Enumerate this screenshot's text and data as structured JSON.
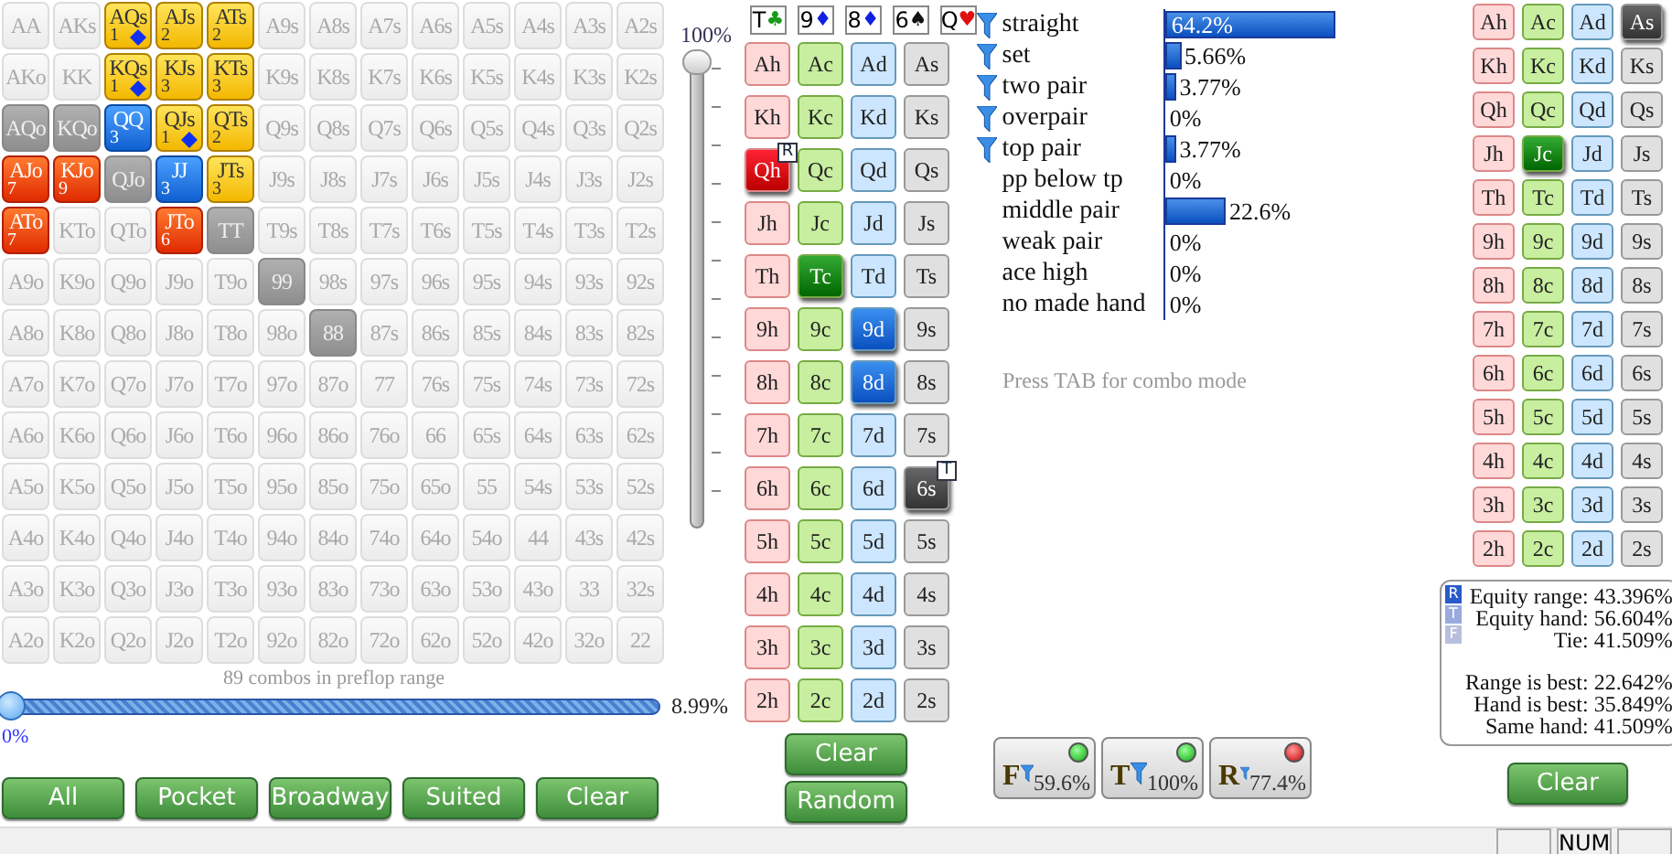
{
  "range_grid": [
    [
      {
        "label": "AA",
        "kind": "none"
      },
      {
        "label": "AKs",
        "kind": "none"
      },
      {
        "label": "AQs",
        "kind": "gold",
        "count": "1",
        "diamond": true
      },
      {
        "label": "AJs",
        "kind": "gold",
        "count": "2",
        "diamond": false
      },
      {
        "label": "ATs",
        "kind": "gold",
        "count": "2",
        "diamond": false
      },
      {
        "label": "A9s",
        "kind": "none"
      },
      {
        "label": "A8s",
        "kind": "none"
      },
      {
        "label": "A7s",
        "kind": "none"
      },
      {
        "label": "A6s",
        "kind": "none"
      },
      {
        "label": "A5s",
        "kind": "none"
      },
      {
        "label": "A4s",
        "kind": "none"
      },
      {
        "label": "A3s",
        "kind": "none"
      },
      {
        "label": "A2s",
        "kind": "none"
      }
    ],
    [
      {
        "label": "AKo",
        "kind": "none"
      },
      {
        "label": "KK",
        "kind": "none"
      },
      {
        "label": "KQs",
        "kind": "gold",
        "count": "1",
        "diamond": true
      },
      {
        "label": "KJs",
        "kind": "gold",
        "count": "3",
        "diamond": false
      },
      {
        "label": "KTs",
        "kind": "gold",
        "count": "3",
        "diamond": false
      },
      {
        "label": "K9s",
        "kind": "none"
      },
      {
        "label": "K8s",
        "kind": "none"
      },
      {
        "label": "K7s",
        "kind": "none"
      },
      {
        "label": "K6s",
        "kind": "none"
      },
      {
        "label": "K5s",
        "kind": "none"
      },
      {
        "label": "K4s",
        "kind": "none"
      },
      {
        "label": "K3s",
        "kind": "none"
      },
      {
        "label": "K2s",
        "kind": "none"
      }
    ],
    [
      {
        "label": "AQo",
        "kind": "gray"
      },
      {
        "label": "KQo",
        "kind": "gray"
      },
      {
        "label": "QQ",
        "kind": "blue",
        "count": "3",
        "diamond": false
      },
      {
        "label": "QJs",
        "kind": "gold",
        "count": "1",
        "diamond": true
      },
      {
        "label": "QTs",
        "kind": "gold",
        "count": "2",
        "diamond": false
      },
      {
        "label": "Q9s",
        "kind": "none"
      },
      {
        "label": "Q8s",
        "kind": "none"
      },
      {
        "label": "Q7s",
        "kind": "none"
      },
      {
        "label": "Q6s",
        "kind": "none"
      },
      {
        "label": "Q5s",
        "kind": "none"
      },
      {
        "label": "Q4s",
        "kind": "none"
      },
      {
        "label": "Q3s",
        "kind": "none"
      },
      {
        "label": "Q2s",
        "kind": "none"
      }
    ],
    [
      {
        "label": "AJo",
        "kind": "red",
        "count": "7",
        "diamond": false
      },
      {
        "label": "KJo",
        "kind": "red",
        "count": "9",
        "diamond": false
      },
      {
        "label": "QJo",
        "kind": "gray"
      },
      {
        "label": "JJ",
        "kind": "blue",
        "count": "3",
        "diamond": false
      },
      {
        "label": "JTs",
        "kind": "gold",
        "count": "3",
        "diamond": false
      },
      {
        "label": "J9s",
        "kind": "none"
      },
      {
        "label": "J8s",
        "kind": "none"
      },
      {
        "label": "J7s",
        "kind": "none"
      },
      {
        "label": "J6s",
        "kind": "none"
      },
      {
        "label": "J5s",
        "kind": "none"
      },
      {
        "label": "J4s",
        "kind": "none"
      },
      {
        "label": "J3s",
        "kind": "none"
      },
      {
        "label": "J2s",
        "kind": "none"
      }
    ],
    [
      {
        "label": "ATo",
        "kind": "red",
        "count": "7",
        "diamond": false
      },
      {
        "label": "KTo",
        "kind": "none"
      },
      {
        "label": "QTo",
        "kind": "none"
      },
      {
        "label": "JTo",
        "kind": "red",
        "count": "6",
        "diamond": false
      },
      {
        "label": "TT",
        "kind": "gray"
      },
      {
        "label": "T9s",
        "kind": "none"
      },
      {
        "label": "T8s",
        "kind": "none"
      },
      {
        "label": "T7s",
        "kind": "none"
      },
      {
        "label": "T6s",
        "kind": "none"
      },
      {
        "label": "T5s",
        "kind": "none"
      },
      {
        "label": "T4s",
        "kind": "none"
      },
      {
        "label": "T3s",
        "kind": "none"
      },
      {
        "label": "T2s",
        "kind": "none"
      }
    ],
    [
      {
        "label": "A9o",
        "kind": "none"
      },
      {
        "label": "K9o",
        "kind": "none"
      },
      {
        "label": "Q9o",
        "kind": "none"
      },
      {
        "label": "J9o",
        "kind": "none"
      },
      {
        "label": "T9o",
        "kind": "none"
      },
      {
        "label": "99",
        "kind": "gray"
      },
      {
        "label": "98s",
        "kind": "none"
      },
      {
        "label": "97s",
        "kind": "none"
      },
      {
        "label": "96s",
        "kind": "none"
      },
      {
        "label": "95s",
        "kind": "none"
      },
      {
        "label": "94s",
        "kind": "none"
      },
      {
        "label": "93s",
        "kind": "none"
      },
      {
        "label": "92s",
        "kind": "none"
      }
    ],
    [
      {
        "label": "A8o",
        "kind": "none"
      },
      {
        "label": "K8o",
        "kind": "none"
      },
      {
        "label": "Q8o",
        "kind": "none"
      },
      {
        "label": "J8o",
        "kind": "none"
      },
      {
        "label": "T8o",
        "kind": "none"
      },
      {
        "label": "98o",
        "kind": "none"
      },
      {
        "label": "88",
        "kind": "gray"
      },
      {
        "label": "87s",
        "kind": "none"
      },
      {
        "label": "86s",
        "kind": "none"
      },
      {
        "label": "85s",
        "kind": "none"
      },
      {
        "label": "84s",
        "kind": "none"
      },
      {
        "label": "83s",
        "kind": "none"
      },
      {
        "label": "82s",
        "kind": "none"
      }
    ],
    [
      {
        "label": "A7o",
        "kind": "none"
      },
      {
        "label": "K7o",
        "kind": "none"
      },
      {
        "label": "Q7o",
        "kind": "none"
      },
      {
        "label": "J7o",
        "kind": "none"
      },
      {
        "label": "T7o",
        "kind": "none"
      },
      {
        "label": "97o",
        "kind": "none"
      },
      {
        "label": "87o",
        "kind": "none"
      },
      {
        "label": "77",
        "kind": "none"
      },
      {
        "label": "76s",
        "kind": "none"
      },
      {
        "label": "75s",
        "kind": "none"
      },
      {
        "label": "74s",
        "kind": "none"
      },
      {
        "label": "73s",
        "kind": "none"
      },
      {
        "label": "72s",
        "kind": "none"
      }
    ],
    [
      {
        "label": "A6o",
        "kind": "none"
      },
      {
        "label": "K6o",
        "kind": "none"
      },
      {
        "label": "Q6o",
        "kind": "none"
      },
      {
        "label": "J6o",
        "kind": "none"
      },
      {
        "label": "T6o",
        "kind": "none"
      },
      {
        "label": "96o",
        "kind": "none"
      },
      {
        "label": "86o",
        "kind": "none"
      },
      {
        "label": "76o",
        "kind": "none"
      },
      {
        "label": "66",
        "kind": "none"
      },
      {
        "label": "65s",
        "kind": "none"
      },
      {
        "label": "64s",
        "kind": "none"
      },
      {
        "label": "63s",
        "kind": "none"
      },
      {
        "label": "62s",
        "kind": "none"
      }
    ],
    [
      {
        "label": "A5o",
        "kind": "none"
      },
      {
        "label": "K5o",
        "kind": "none"
      },
      {
        "label": "Q5o",
        "kind": "none"
      },
      {
        "label": "J5o",
        "kind": "none"
      },
      {
        "label": "T5o",
        "kind": "none"
      },
      {
        "label": "95o",
        "kind": "none"
      },
      {
        "label": "85o",
        "kind": "none"
      },
      {
        "label": "75o",
        "kind": "none"
      },
      {
        "label": "65o",
        "kind": "none"
      },
      {
        "label": "55",
        "kind": "none"
      },
      {
        "label": "54s",
        "kind": "none"
      },
      {
        "label": "53s",
        "kind": "none"
      },
      {
        "label": "52s",
        "kind": "none"
      }
    ],
    [
      {
        "label": "A4o",
        "kind": "none"
      },
      {
        "label": "K4o",
        "kind": "none"
      },
      {
        "label": "Q4o",
        "kind": "none"
      },
      {
        "label": "J4o",
        "kind": "none"
      },
      {
        "label": "T4o",
        "kind": "none"
      },
      {
        "label": "94o",
        "kind": "none"
      },
      {
        "label": "84o",
        "kind": "none"
      },
      {
        "label": "74o",
        "kind": "none"
      },
      {
        "label": "64o",
        "kind": "none"
      },
      {
        "label": "54o",
        "kind": "none"
      },
      {
        "label": "44",
        "kind": "none"
      },
      {
        "label": "43s",
        "kind": "none"
      },
      {
        "label": "42s",
        "kind": "none"
      }
    ],
    [
      {
        "label": "A3o",
        "kind": "none"
      },
      {
        "label": "K3o",
        "kind": "none"
      },
      {
        "label": "Q3o",
        "kind": "none"
      },
      {
        "label": "J3o",
        "kind": "none"
      },
      {
        "label": "T3o",
        "kind": "none"
      },
      {
        "label": "93o",
        "kind": "none"
      },
      {
        "label": "83o",
        "kind": "none"
      },
      {
        "label": "73o",
        "kind": "none"
      },
      {
        "label": "63o",
        "kind": "none"
      },
      {
        "label": "53o",
        "kind": "none"
      },
      {
        "label": "43o",
        "kind": "none"
      },
      {
        "label": "33",
        "kind": "none"
      },
      {
        "label": "32s",
        "kind": "none"
      }
    ],
    [
      {
        "label": "A2o",
        "kind": "none"
      },
      {
        "label": "K2o",
        "kind": "none"
      },
      {
        "label": "Q2o",
        "kind": "none"
      },
      {
        "label": "J2o",
        "kind": "none"
      },
      {
        "label": "T2o",
        "kind": "none"
      },
      {
        "label": "92o",
        "kind": "none"
      },
      {
        "label": "82o",
        "kind": "none"
      },
      {
        "label": "72o",
        "kind": "none"
      },
      {
        "label": "62o",
        "kind": "none"
      },
      {
        "label": "52o",
        "kind": "none"
      },
      {
        "label": "42o",
        "kind": "none"
      },
      {
        "label": "32o",
        "kind": "none"
      },
      {
        "label": "22",
        "kind": "none"
      }
    ]
  ],
  "vertical_slider": {
    "label": "100%",
    "level": 1
  },
  "range_slider": {
    "caption": "89 combos in preflop range",
    "level": 0,
    "min_label": "0%",
    "reading": "8.99%"
  },
  "range_buttons": [
    "All",
    "Pocket",
    "Broadway",
    "Suited",
    "Clear"
  ],
  "board": [
    {
      "rank": "T",
      "symbol": "♣",
      "kind": "clubs"
    },
    {
      "rank": "9",
      "symbol": "♦",
      "kind": "diamonds"
    },
    {
      "rank": "8",
      "symbol": "♦",
      "kind": "diamonds"
    },
    {
      "rank": "6",
      "symbol": "♠",
      "kind": "spades"
    },
    {
      "rank": "Q",
      "symbol": "♥",
      "kind": "hearts"
    }
  ],
  "deck": [
    {
      "kind": "hearts",
      "cards": [
        {
          "label": "Ah",
          "selected": false
        },
        {
          "label": "Kh",
          "selected": false
        },
        {
          "label": "Qh",
          "selected": true,
          "tag": "R"
        },
        {
          "label": "Jh",
          "selected": false
        },
        {
          "label": "Th",
          "selected": false
        },
        {
          "label": "9h",
          "selected": false
        },
        {
          "label": "8h",
          "selected": false
        },
        {
          "label": "7h",
          "selected": false
        },
        {
          "label": "6h",
          "selected": false
        },
        {
          "label": "5h",
          "selected": false
        },
        {
          "label": "4h",
          "selected": false
        },
        {
          "label": "3h",
          "selected": false
        },
        {
          "label": "2h",
          "selected": false
        }
      ]
    },
    {
      "kind": "clubs",
      "cards": [
        {
          "label": "Ac",
          "selected": false
        },
        {
          "label": "Kc",
          "selected": false
        },
        {
          "label": "Qc",
          "selected": false
        },
        {
          "label": "Jc",
          "selected": false
        },
        {
          "label": "Tc",
          "selected": true
        },
        {
          "label": "9c",
          "selected": false
        },
        {
          "label": "8c",
          "selected": false
        },
        {
          "label": "7c",
          "selected": false
        },
        {
          "label": "6c",
          "selected": false
        },
        {
          "label": "5c",
          "selected": false
        },
        {
          "label": "4c",
          "selected": false
        },
        {
          "label": "3c",
          "selected": false
        },
        {
          "label": "2c",
          "selected": false
        }
      ]
    },
    {
      "kind": "diamonds",
      "cards": [
        {
          "label": "Ad",
          "selected": false
        },
        {
          "label": "Kd",
          "selected": false
        },
        {
          "label": "Qd",
          "selected": false
        },
        {
          "label": "Jd",
          "selected": false
        },
        {
          "label": "Td",
          "selected": false
        },
        {
          "label": "9d",
          "selected": true
        },
        {
          "label": "8d",
          "selected": true
        },
        {
          "label": "7d",
          "selected": false
        },
        {
          "label": "6d",
          "selected": false
        },
        {
          "label": "5d",
          "selected": false
        },
        {
          "label": "4d",
          "selected": false
        },
        {
          "label": "3d",
          "selected": false
        },
        {
          "label": "2d",
          "selected": false
        }
      ]
    },
    {
      "kind": "spades",
      "cards": [
        {
          "label": "As",
          "selected": false
        },
        {
          "label": "Ks",
          "selected": false
        },
        {
          "label": "Qs",
          "selected": false
        },
        {
          "label": "Js",
          "selected": false
        },
        {
          "label": "Ts",
          "selected": false
        },
        {
          "label": "9s",
          "selected": false
        },
        {
          "label": "8s",
          "selected": false
        },
        {
          "label": "7s",
          "selected": false
        },
        {
          "label": "6s",
          "selected": true,
          "tag": "T"
        },
        {
          "label": "5s",
          "selected": false
        },
        {
          "label": "4s",
          "selected": false
        },
        {
          "label": "3s",
          "selected": false
        },
        {
          "label": "2s",
          "selected": false
        }
      ]
    }
  ],
  "deck_buttons": [
    "Clear",
    "Random"
  ],
  "categories": [
    {
      "label": "straight",
      "filter": true,
      "level": 0.642,
      "reading": "64.2%"
    },
    {
      "label": "set",
      "filter": true,
      "level": 0.0566,
      "reading": "5.66%"
    },
    {
      "label": "two pair",
      "filter": true,
      "level": 0.0377,
      "reading": "3.77%"
    },
    {
      "label": "overpair",
      "filter": true,
      "reading": "0%"
    },
    {
      "label": "top pair",
      "filter": true,
      "level": 0.0377,
      "reading": "3.77%"
    },
    {
      "label": "pp below tp",
      "filter": false,
      "reading": "0%"
    },
    {
      "label": "middle pair",
      "filter": false,
      "level": 0.226,
      "reading": "22.6%"
    },
    {
      "label": "weak pair",
      "filter": false,
      "reading": "0%"
    },
    {
      "label": "ace high",
      "filter": false,
      "reading": "0%"
    },
    {
      "label": "no made hand",
      "filter": false,
      "reading": "0%"
    }
  ],
  "hint": "Press TAB for combo mode",
  "street_filters": [
    {
      "letter": "F",
      "reading": "59.6%",
      "on": true
    },
    {
      "letter": "T",
      "reading": "100%",
      "on": true
    },
    {
      "letter": "R",
      "reading": "77.4%",
      "on": false
    }
  ],
  "hand_deck": [
    {
      "kind": "hearts",
      "cards": [
        {
          "label": "Ah",
          "selected": false
        },
        {
          "label": "Kh",
          "selected": false
        },
        {
          "label": "Qh",
          "selected": false
        },
        {
          "label": "Jh",
          "selected": false
        },
        {
          "label": "Th",
          "selected": false
        },
        {
          "label": "9h",
          "selected": false
        },
        {
          "label": "8h",
          "selected": false
        },
        {
          "label": "7h",
          "selected": false
        },
        {
          "label": "6h",
          "selected": false
        },
        {
          "label": "5h",
          "selected": false
        },
        {
          "label": "4h",
          "selected": false
        },
        {
          "label": "3h",
          "selected": false
        },
        {
          "label": "2h",
          "selected": false
        }
      ]
    },
    {
      "kind": "clubs",
      "cards": [
        {
          "label": "Ac",
          "selected": false
        },
        {
          "label": "Kc",
          "selected": false
        },
        {
          "label": "Qc",
          "selected": false
        },
        {
          "label": "Jc",
          "selected": true
        },
        {
          "label": "Tc",
          "selected": false
        },
        {
          "label": "9c",
          "selected": false
        },
        {
          "label": "8c",
          "selected": false
        },
        {
          "label": "7c",
          "selected": false
        },
        {
          "label": "6c",
          "selected": false
        },
        {
          "label": "5c",
          "selected": false
        },
        {
          "label": "4c",
          "selected": false
        },
        {
          "label": "3c",
          "selected": false
        },
        {
          "label": "2c",
          "selected": false
        }
      ]
    },
    {
      "kind": "diamonds",
      "cards": [
        {
          "label": "Ad",
          "selected": false
        },
        {
          "label": "Kd",
          "selected": false
        },
        {
          "label": "Qd",
          "selected": false
        },
        {
          "label": "Jd",
          "selected": false
        },
        {
          "label": "Td",
          "selected": false
        },
        {
          "label": "9d",
          "selected": false
        },
        {
          "label": "8d",
          "selected": false
        },
        {
          "label": "7d",
          "selected": false
        },
        {
          "label": "6d",
          "selected": false
        },
        {
          "label": "5d",
          "selected": false
        },
        {
          "label": "4d",
          "selected": false
        },
        {
          "label": "3d",
          "selected": false
        },
        {
          "label": "2d",
          "selected": false
        }
      ]
    },
    {
      "kind": "spades",
      "cards": [
        {
          "label": "As",
          "selected": true
        },
        {
          "label": "Ks",
          "selected": false
        },
        {
          "label": "Qs",
          "selected": false
        },
        {
          "label": "Js",
          "selected": false
        },
        {
          "label": "Ts",
          "selected": false
        },
        {
          "label": "9s",
          "selected": false
        },
        {
          "label": "8s",
          "selected": false
        },
        {
          "label": "7s",
          "selected": false
        },
        {
          "label": "6s",
          "selected": false
        },
        {
          "label": "5s",
          "selected": false
        },
        {
          "label": "4s",
          "selected": false
        },
        {
          "label": "3s",
          "selected": false
        },
        {
          "label": "2s",
          "selected": false
        }
      ]
    }
  ],
  "results": {
    "badges": [
      "R",
      "T",
      "F"
    ],
    "equity": [
      "Equity range: 43.396%",
      "Equity hand: 56.604%",
      "Tie: 41.509%"
    ],
    "outcomes": [
      "Range is best: 22.642%",
      "Hand is best: 35.849%",
      "Same hand: 41.509%"
    ]
  },
  "results_button": "Clear",
  "status_bar": {
    "panels": [
      "NUM"
    ]
  }
}
